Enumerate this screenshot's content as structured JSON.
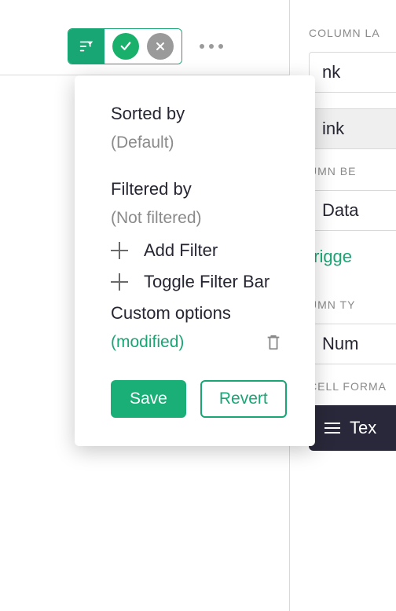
{
  "toolbar": {
    "filter_icon": "filter-icon",
    "confirm_icon": "check-icon",
    "cancel_icon": "x-icon",
    "more_icon": "ellipsis-icon"
  },
  "dropdown": {
    "sorted_by_title": "Sorted by",
    "sorted_by_value": "(Default)",
    "filtered_by_title": "Filtered by",
    "filtered_by_value": "(Not filtered)",
    "add_filter_label": "Add Filter",
    "toggle_filter_bar_label": "Toggle Filter Bar",
    "custom_options_title": "Custom options",
    "custom_options_status": "(modified)",
    "save_label": "Save",
    "revert_label": "Revert"
  },
  "right_panel": {
    "label1": "COLUMN LA",
    "field1": "nk",
    "field2": "ink",
    "label2": "UMN BE",
    "field3": "Data",
    "trigger": "trigge",
    "label3": "UMN TY",
    "field4": "Num",
    "label4": "CELL FORMA",
    "dark_btn": "Tex"
  }
}
